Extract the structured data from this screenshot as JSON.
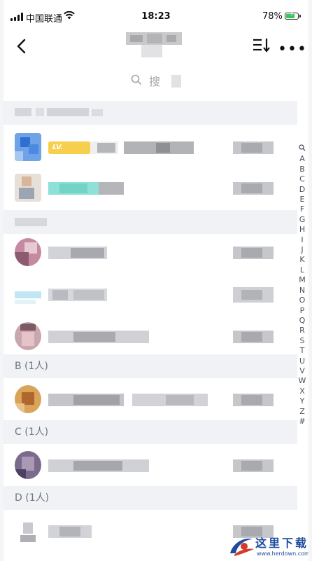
{
  "status_bar": {
    "carrier": "中国联通",
    "time": "18:23",
    "battery_percent": "78%",
    "battery_level": 0.78,
    "wifi_icon": "wifi-icon"
  },
  "nav": {
    "back_icon": "chevron-left-icon",
    "sort_icon": "sort-icon",
    "more_label": "•••"
  },
  "search": {
    "placeholder": "搜"
  },
  "sections": [
    {
      "label": ""
    },
    {
      "label": ""
    },
    {
      "label": "B (1人)"
    },
    {
      "label": "C (1人)"
    },
    {
      "label": "D (1人)"
    }
  ],
  "badge": {
    "label": "LV."
  },
  "alphabet": [
    "A",
    "B",
    "C",
    "D",
    "E",
    "F",
    "G",
    "H",
    "I",
    "J",
    "K",
    "L",
    "M",
    "N",
    "O",
    "P",
    "Q",
    "R",
    "S",
    "T",
    "U",
    "V",
    "W",
    "X",
    "Y",
    "Z",
    "#"
  ],
  "watermark": {
    "text": "这里下载",
    "url": "www.herdown.com"
  },
  "colors": {
    "accent_battery": "#35c75a",
    "section_bg": "#f0f2f6",
    "section_text": "#6f7480"
  }
}
